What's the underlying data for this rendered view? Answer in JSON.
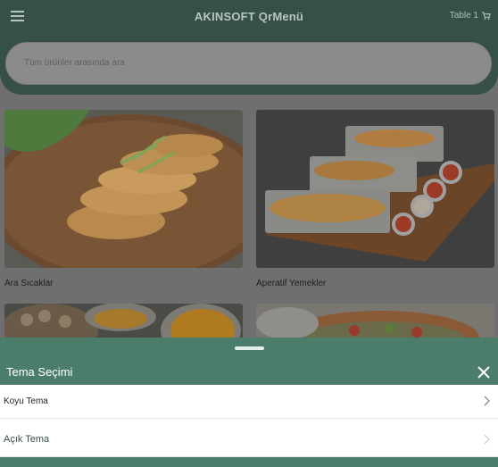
{
  "header": {
    "title": "AKINSOFT QrMenü",
    "table_label": "Table 1"
  },
  "search": {
    "placeholder": "Tüm ürünler arasında ara"
  },
  "categories": [
    {
      "label": "Ara Sıcaklar"
    },
    {
      "label": "Aperatif Yemekler"
    }
  ],
  "theme_sheet": {
    "title": "Tema Seçimi",
    "items": [
      {
        "label": "Koyu Tema"
      },
      {
        "label": "Açık Tema"
      }
    ]
  },
  "colors": {
    "header_bg": "#365046",
    "sheet_bg": "#4c7c6a",
    "accent": "#365046"
  },
  "icons": [
    "menu-icon",
    "cart-icon",
    "close-icon",
    "chevron-right-icon"
  ]
}
